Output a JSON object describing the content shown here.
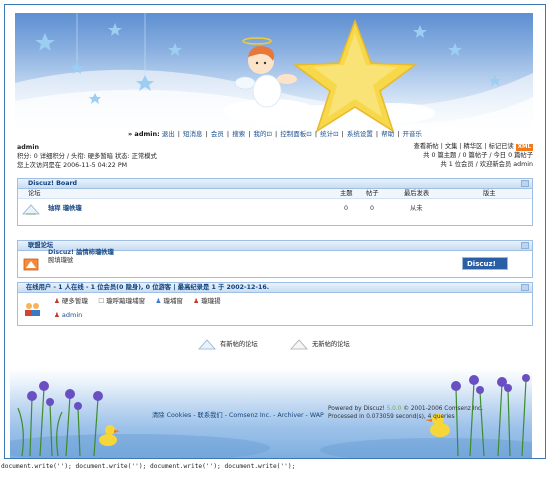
{
  "nav": {
    "user": "» admin:",
    "items": [
      "退出",
      "短消息",
      "会员",
      "搜索",
      "我的⊡",
      "控制面板⊡",
      "统计⊡",
      "系统设置",
      "帮助",
      "开音乐"
    ]
  },
  "user_info": {
    "name": "admin",
    "line2": "积分: 0 详细积分 / 头衔: 硬多暂暗 状态: 正常模式",
    "line3": "您上次访问是在 2006-11-5 04:22 PM"
  },
  "right_info": {
    "links": "查看新帖 | 文集 | 精华区 | 标记已读",
    "xml": "XML",
    "line2": "共 0 篇主题 / 0 篇帖子 / 今日 0 篇帖子",
    "line3": "共 1 位会员 / 欢迎新会员 admin"
  },
  "board": {
    "title": "Discuz! Board",
    "col_forum": "论坛",
    "col_topics": "主题",
    "col_posts": "帖子",
    "col_last": "最后发表",
    "col_mod": "版主",
    "forum_name": "轴稈  瓏帙瓏",
    "topics": "0",
    "posts": "0",
    "last": "从未"
  },
  "links": {
    "title": "联盟论坛",
    "site_name": "Discuz! 論情柿瓏帙瓏",
    "site_desc": "腕填瓏號"
  },
  "online": {
    "title": "在线用户 - 1 人在线 - 1 位会员(0 隐身), 0 位游客 | 最高纪录是 1 于 2002-12-16.",
    "roles": [
      "硬多暂瓏",
      "瓏呼黯瓏埔窗",
      "瓏埔窗",
      "瓏瓏揚"
    ],
    "user": "admin"
  },
  "legend": {
    "new": "有新帖的论坛",
    "nonew": "无新帖的论坛"
  },
  "footer": {
    "links": "清除 Cookies - 联系我们 - Comsenz Inc. - Archiver - WAP",
    "powered": "Powered by Discuz!",
    "version": "5.0.0",
    "copyright": "© 2001-2006 Comsenz Inc.",
    "processed": "Processed in 0.073059 second(s), 4 queries"
  },
  "bottom_code": "document.write(''); document.write(''); document.write(''); document.write('');",
  "colors": {
    "accent": "#3c78b4",
    "header_text": "#0f3f7a",
    "xml_badge": "#f07a1a"
  }
}
